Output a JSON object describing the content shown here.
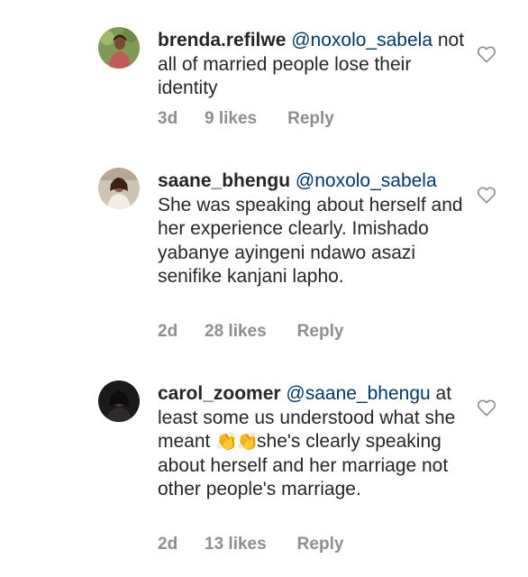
{
  "comments": [
    {
      "username": "brenda.refilwe",
      "mention": "@noxolo_sabela",
      "text": "not all of married people lose their identity",
      "age": "3d",
      "likes": "9 likes",
      "reply": "Reply",
      "avatar_icon": "avatar-woman-outdoors",
      "avatar_colors": {
        "bg": "#7f9a55",
        "skin": "#7b4a35",
        "shirt": "#c25a55"
      }
    },
    {
      "username": "saane_bhengu",
      "mention": "@noxolo_sabela",
      "text": "She was speaking about herself and her experience clearly. Imishado yabanye ayingeni ndawo asazi senifike kanjani lapho.",
      "age": "2d",
      "likes": "28 likes",
      "reply": "Reply",
      "avatar_icon": "avatar-woman-light",
      "avatar_colors": {
        "bg": "#cfc4b3",
        "skin": "#8a5a45",
        "shirt": "#f1ece4"
      }
    },
    {
      "username": "carol_zoomer",
      "mention": "@saane_bhengu",
      "text_before_emoji": "at least some us understood what she meant ",
      "emoji": "👏👏",
      "text_after_emoji": "she's clearly speaking about herself and her marriage not other people's marriage.",
      "age": "2d",
      "likes": "13 likes",
      "reply": "Reply",
      "avatar_icon": "avatar-woman-dark",
      "avatar_colors": {
        "bg": "#1a1a1a",
        "skin": "#5a3526",
        "shirt": "#2b2b2b"
      }
    }
  ],
  "colors": {
    "text": "#262626",
    "mention": "#00376b",
    "meta": "#8e8e8e",
    "heart_stroke": "#8e8e8e"
  },
  "icons": {
    "like": "heart-outline-icon"
  }
}
